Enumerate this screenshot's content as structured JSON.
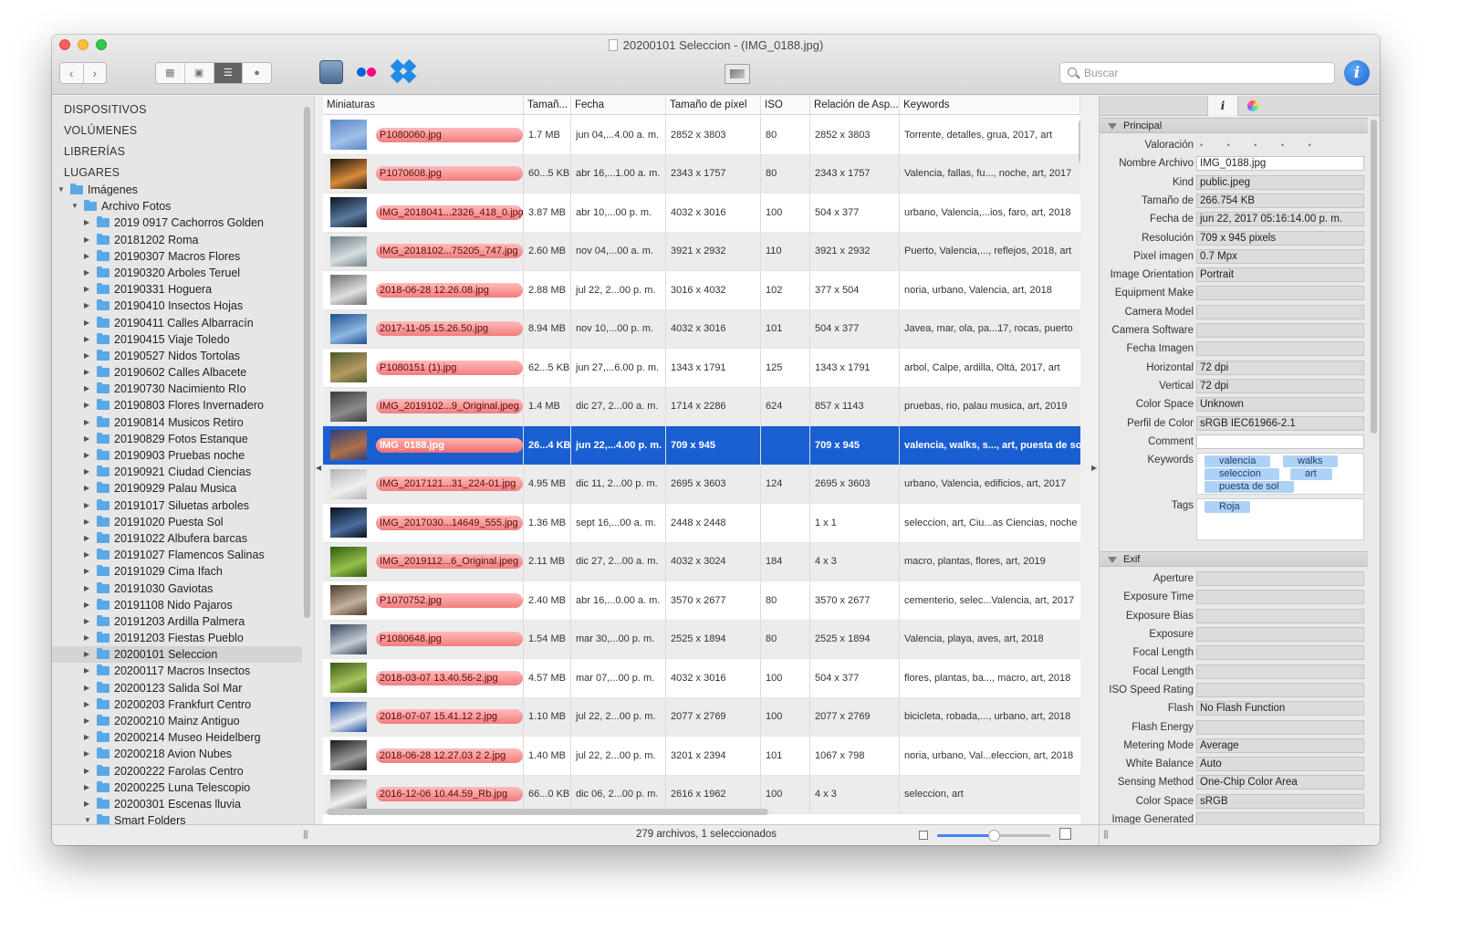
{
  "window": {
    "title": "20200101 Seleccion - (IMG_0188.jpg)"
  },
  "toolbar": {
    "back_glyph": "‹",
    "forward_glyph": "›",
    "view_modes": [
      "grid-small-icon",
      "grid-large-icon",
      "list-icon",
      "map-pin-icon"
    ],
    "active_view": 2,
    "search_placeholder": "Buscar",
    "info_glyph": "i"
  },
  "sidebar": {
    "sections": [
      "DISPOSITIVOS",
      "VOLÚMENES",
      "LIBRERÍAS",
      "LUGARES"
    ],
    "root": "Imágenes",
    "parent": "Archivo Fotos",
    "folders": [
      "2019 0917 Cachorros Golden",
      "20181202 Roma",
      "20190307 Macros Flores",
      "20190320 Arboles Teruel",
      "20190331 Hoguera",
      "20190410 Insectos Hojas",
      "20190411 Calles Albarracín",
      "20190415 Viaje Toledo",
      "20190527 Nidos Tortolas",
      "20190602 Calles Albacete",
      "20190730 Nacimiento RIo",
      "20190803 Flores Invernadero",
      "20190814 Musicos Retiro",
      "20190829 Fotos Estanque",
      "20190903 Pruebas noche",
      "20190921 Ciudad Ciencias",
      "20190929 Palau Musica",
      "20191017 Siluetas arboles",
      "20191020 Puesta Sol",
      "20191022 Albufera barcas",
      "20191027 Flamencos Salinas",
      "20191029 Cima Ifach",
      "20191030 Gaviotas",
      "20191108 Nido Pajaros",
      "20191203 Ardilla Palmera",
      "20191203 Fiestas Pueblo",
      "20200101 Seleccion",
      "20200117 Macros Insectos",
      "20200123 Salida Sol Mar",
      "20200203 Frankfurt Centro",
      "20200210 Mainz Antiguo",
      "20200214 Museo Heidelberg",
      "20200218 Avion Nubes",
      "20200222 Farolas Centro",
      "20200225 Luna Telescopio",
      "20200301 Escenas lluvia"
    ],
    "selected_folder": "20200101 Seleccion",
    "smart_folders": "Smart Folders"
  },
  "list": {
    "columns": [
      "Miniaturas",
      "Tamañ...",
      "Fecha",
      "Tamaño de píxel",
      "ISO",
      "Relación de Asp...",
      "Keywords"
    ],
    "rows": [
      {
        "name": "P1080060.jpg",
        "size": "1.7 MB",
        "date": "jun 04,...4.00 a. m.",
        "pix": "2852 x 3803",
        "iso": "80",
        "aspect": "2852 x 3803",
        "kw": "Torrente, detalles, grua, 2017, art",
        "thumb": [
          "#5b86c4",
          "#9ec1ea"
        ]
      },
      {
        "name": "P1070608.jpg",
        "size": "60...5 KB",
        "date": "abr 16,...1.00 a. m.",
        "pix": "2343 x 1757",
        "iso": "80",
        "aspect": "2343 x 1757",
        "kw": "Valencia, fallas, fu..., noche, art, 2017",
        "thumb": [
          "#1b1510",
          "#d88a3a"
        ]
      },
      {
        "name": "IMG_2018041...2326_418_0.jpg",
        "size": "3.87 MB",
        "date": "abr 10,...00 p. m.",
        "pix": "4032 x 3016",
        "iso": "100",
        "aspect": "504 x 377",
        "kw": "urbano, Valencia,...ios, faro, art, 2018",
        "thumb": [
          "#0d1624",
          "#5a7aa0"
        ]
      },
      {
        "name": "IMG_2018102...75205_747.jpg",
        "size": "2.60 MB",
        "date": "nov 04,...00 a. m.",
        "pix": "3921 x 2932",
        "iso": "110",
        "aspect": "3921 x 2932",
        "kw": "Puerto, Valencia,..., reflejos, 2018, art",
        "thumb": [
          "#6f7e86",
          "#d6dde0"
        ]
      },
      {
        "name": "2018-06-28 12.26.08.jpg",
        "size": "2.88 MB",
        "date": "jul 22, 2...00 p. m.",
        "pix": "3016 x 4032",
        "iso": "102",
        "aspect": "377 x 504",
        "kw": "noria, urbano, Valencia, art, 2018",
        "thumb": [
          "#6f6f6f",
          "#dedede"
        ]
      },
      {
        "name": "2017-11-05 15.26.50.jpg",
        "size": "8.94 MB",
        "date": "nov 10,...00 p. m.",
        "pix": "4032 x 3016",
        "iso": "101",
        "aspect": "504 x 377",
        "kw": "Javea, mar, ola, pa...17, rocas, puerto",
        "thumb": [
          "#20508f",
          "#8eb6e0"
        ]
      },
      {
        "name": "P1080151 (1).jpg",
        "size": "62...5 KB",
        "date": "jun 27,...6.00 p. m.",
        "pix": "1343 x 1791",
        "iso": "125",
        "aspect": "1343 x 1791",
        "kw": "arbol, Calpe, ardilla, Oltá, 2017, art",
        "thumb": [
          "#4d5a2a",
          "#b69a62"
        ]
      },
      {
        "name": "IMG_2019102...9_Original.jpeg",
        "size": "1.4 MB",
        "date": "dic 27, 2...00 a. m.",
        "pix": "1714 x 2286",
        "iso": "624",
        "aspect": "857 x 1143",
        "kw": "pruebas, rio, palau musica, art, 2019",
        "thumb": [
          "#3b3b3b",
          "#8b8b8b"
        ]
      },
      {
        "name": "IMG_0188.jpg",
        "size": "26...4 KB",
        "date": "jun 22,...4.00 p. m.",
        "pix": "709 x 945",
        "iso": "",
        "aspect": "709 x 945",
        "kw": "valencia, walks, s..., art, puesta de sol",
        "thumb": [
          "#2c3f78",
          "#b07048"
        ]
      },
      {
        "name": "IMG_2017121...31_224-01.jpg",
        "size": "4.95 MB",
        "date": "dic 11, 2...00 p. m.",
        "pix": "2695 x 3603",
        "iso": "124",
        "aspect": "2695 x 3603",
        "kw": "urbano, Valencia, edificios, art, 2017",
        "thumb": [
          "#b4b4b4",
          "#f0f0f0"
        ]
      },
      {
        "name": "IMG_2017030...14649_555.jpg",
        "size": "1.36 MB",
        "date": "sept 16,...00 a. m.",
        "pix": "2448 x 2448",
        "iso": "",
        "aspect": "1 x 1",
        "kw": "seleccion, art, Ciu...as Ciencias, noche",
        "thumb": [
          "#08101e",
          "#4b6d9e"
        ]
      },
      {
        "name": "IMG_2019112...6_Original.jpeg",
        "size": "2.11 MB",
        "date": "dic 27, 2...00 a. m.",
        "pix": "4032 x 3024",
        "iso": "184",
        "aspect": "4 x 3",
        "kw": "macro, plantas, flores, art, 2019",
        "thumb": [
          "#2f5a12",
          "#93c04a"
        ]
      },
      {
        "name": "P1070752.jpg",
        "size": "2.40 MB",
        "date": "abr 16,...0.00 a. m.",
        "pix": "3570 x 2677",
        "iso": "80",
        "aspect": "3570 x 2677",
        "kw": "cementerio, selec...Valencia, art, 2017",
        "thumb": [
          "#4a3d2c",
          "#c3b09a"
        ]
      },
      {
        "name": "P1080648.jpg",
        "size": "1.54 MB",
        "date": "mar 30,...00 p. m.",
        "pix": "2525 x 1894",
        "iso": "80",
        "aspect": "2525 x 1894",
        "kw": "Valencia, playa, aves, art, 2018",
        "thumb": [
          "#34435a",
          "#c4ccd6"
        ]
      },
      {
        "name": "2018-03-07 13.40.56-2.jpg",
        "size": "4.57 MB",
        "date": "mar 07,...00 p. m.",
        "pix": "4032 x 3016",
        "iso": "100",
        "aspect": "504 x 377",
        "kw": "flores, plantas, ba..., macro, art, 2018",
        "thumb": [
          "#3d5c16",
          "#a6c25c"
        ]
      },
      {
        "name": "2018-07-07 15.41.12 2.jpg",
        "size": "1.10 MB",
        "date": "jul 22, 2...00 p. m.",
        "pix": "2077 x 2769",
        "iso": "100",
        "aspect": "2077 x 2769",
        "kw": "bicicleta, robada,..., urbano, art, 2018",
        "thumb": [
          "#1c4da0",
          "#dfe6f0"
        ]
      },
      {
        "name": "2018-06-28 12.27.03 2 2.jpg",
        "size": "1.40 MB",
        "date": "jul 22, 2...00 p. m.",
        "pix": "3201 x 2394",
        "iso": "101",
        "aspect": "1067 x 798",
        "kw": "noria, urbano, Val...eleccion, art, 2018",
        "thumb": [
          "#1a1a1a",
          "#9a9a9a"
        ]
      },
      {
        "name": "2016-12-06 10.44.59_Rb.jpg",
        "size": "66...0 KB",
        "date": "dic 06, 2...00 p. m.",
        "pix": "2616 x 1962",
        "iso": "100",
        "aspect": "4 x 3",
        "kw": "seleccion, art",
        "thumb": [
          "#707070",
          "#f2f2f2"
        ]
      }
    ],
    "selected_row": 8
  },
  "status": {
    "text": "279 archivos, 1 seleccionados",
    "zoom_level": 0.5
  },
  "inspector": {
    "tabs": [
      "i",
      "color-wheel-icon"
    ],
    "principal_title": "Principal",
    "principal": [
      {
        "label": "Valoración",
        "value": "• • • • •",
        "kind": "stars"
      },
      {
        "label": "Nombre Archivo",
        "value": "IMG_0188.jpg",
        "kind": "white"
      },
      {
        "label": "Kind",
        "value": "public.jpeg"
      },
      {
        "label": "Tamaño de",
        "value": "266.754 KB"
      },
      {
        "label": "Fecha de",
        "value": "jun 22, 2017 05:16:14.00 p. m."
      },
      {
        "label": "Resolución",
        "value": "709 x 945 pixels"
      },
      {
        "label": "Pixel imagen",
        "value": "0.7 Mpx"
      },
      {
        "label": "Image Orientation",
        "value": "Portrait"
      },
      {
        "label": "Equipment Make",
        "value": ""
      },
      {
        "label": "Camera Model",
        "value": ""
      },
      {
        "label": "Camera Software",
        "value": ""
      },
      {
        "label": "Fecha Imagen",
        "value": ""
      },
      {
        "label": "Horizontal",
        "value": "72 dpi"
      },
      {
        "label": "Vertical",
        "value": "72 dpi"
      },
      {
        "label": "Color Space",
        "value": "Unknown"
      },
      {
        "label": "Perfil de Color",
        "value": "sRGB IEC61966-2.1"
      },
      {
        "label": "Comment",
        "value": "",
        "kind": "white"
      }
    ],
    "keywords_label": "Keywords",
    "keywords": [
      "valencia",
      "walks",
      "seleccion",
      "art",
      "puesta de sol"
    ],
    "tags_label": "Tags",
    "tags": [
      "Roja"
    ],
    "exif_title": "Exif",
    "exif": [
      {
        "label": "Aperture",
        "value": ""
      },
      {
        "label": "Exposure Time",
        "value": ""
      },
      {
        "label": "Exposure Bias",
        "value": ""
      },
      {
        "label": "Exposure",
        "value": ""
      },
      {
        "label": "Focal Length",
        "value": ""
      },
      {
        "label": "Focal Length",
        "value": ""
      },
      {
        "label": "ISO Speed Rating",
        "value": ""
      },
      {
        "label": "Flash",
        "value": "No Flash Function"
      },
      {
        "label": "Flash Energy",
        "value": ""
      },
      {
        "label": "Metering Mode",
        "value": "Average"
      },
      {
        "label": "White Balance",
        "value": "Auto"
      },
      {
        "label": "Sensing Method",
        "value": "One-Chip Color Area"
      },
      {
        "label": "Color Space",
        "value": "sRGB"
      },
      {
        "label": "Image Generated",
        "value": ""
      },
      {
        "label": "Image Digitized",
        "value": ""
      }
    ]
  }
}
